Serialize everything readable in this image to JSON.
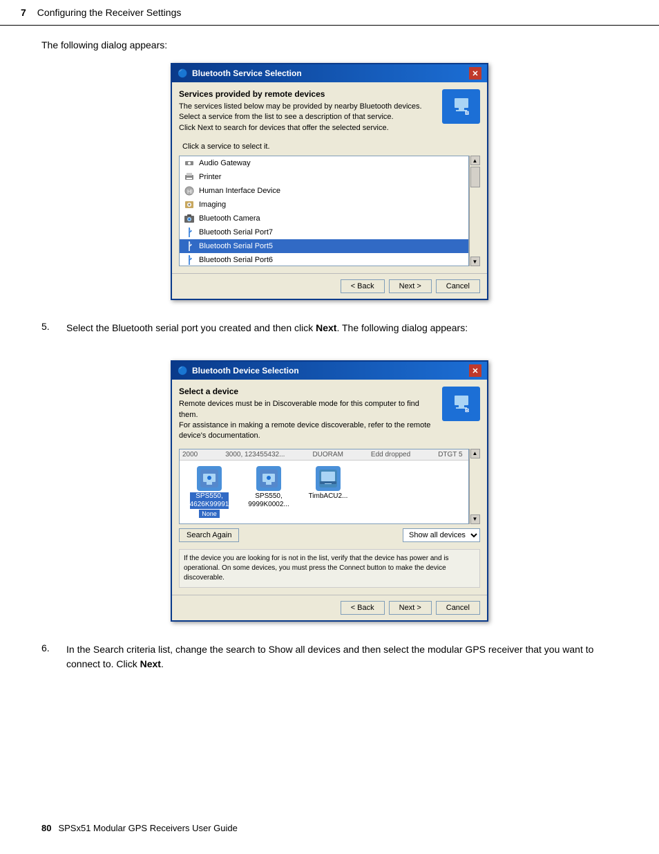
{
  "page": {
    "chapter_num": "7",
    "chapter_title": "Configuring the Receiver Settings",
    "footer_page_num": "80",
    "footer_title": "SPSx51 Modular GPS Receivers User Guide"
  },
  "intro": {
    "text": "The following dialog appears:"
  },
  "dialog1": {
    "title": "Bluetooth Service Selection",
    "header_title": "Services provided by remote devices",
    "header_desc": "The services listed below may be provided by nearby Bluetooth devices.\nSelect a service from the list to see a description of that service.\nClick Next to search for devices that offer the selected service.",
    "select_label": "Click a service to select it.",
    "services": [
      {
        "name": "Audio Gateway",
        "icon": "audio"
      },
      {
        "name": "Printer",
        "icon": "printer"
      },
      {
        "name": "Human Interface Device",
        "icon": "hid"
      },
      {
        "name": "Imaging",
        "icon": "imaging"
      },
      {
        "name": "Bluetooth Camera",
        "icon": "bt-camera"
      },
      {
        "name": "Bluetooth Serial Port7",
        "icon": "bt-serial"
      },
      {
        "name": "Bluetooth Serial Port5",
        "icon": "bt-serial",
        "selected": true
      },
      {
        "name": "Bluetooth Serial Port6",
        "icon": "bt-serial"
      }
    ],
    "btn_back": "< Back",
    "btn_next": "Next >",
    "btn_cancel": "Cancel"
  },
  "step5": {
    "number": "5.",
    "text_before": "Select the Bluetooth serial port you created and then click ",
    "bold_word": "Next",
    "text_after": ". The following dialog appears:"
  },
  "dialog2": {
    "title": "Bluetooth Device Selection",
    "header_title": "Select a device",
    "header_desc": "Remote devices must be in Discoverable mode for this computer to find them.\nFor assistance in making a remote device discoverable, refer to the remote\ndevice's documentation.",
    "col_headers": [
      "2000",
      "3000, 123455432...",
      "DUORAM",
      "EDD dropped",
      "DTGT 5"
    ],
    "devices": [
      {
        "name": "SPS550,\n4626K99991\nNone",
        "selected": true,
        "icon": "gps"
      },
      {
        "name": "SPS550,\n9999K0002...",
        "selected": false,
        "icon": "gps"
      },
      {
        "name": "TimbACU2...",
        "selected": false,
        "icon": "laptop"
      }
    ],
    "btn_search": "Search Again",
    "dropdown_label": "Show all devices",
    "info_text": "If the device you are looking for is not in the list, verify that the device has power and is operational. On some devices, you must press the Connect button to make the device discoverable.",
    "btn_back": "< Back",
    "btn_next": "Next >",
    "btn_cancel": "Cancel"
  },
  "step6": {
    "number": "6.",
    "text_before": "In the Search criteria list, change the search to Show all devices and then select the modular GPS receiver that you want to connect to. Click ",
    "bold_word": "Next",
    "text_after": "."
  }
}
